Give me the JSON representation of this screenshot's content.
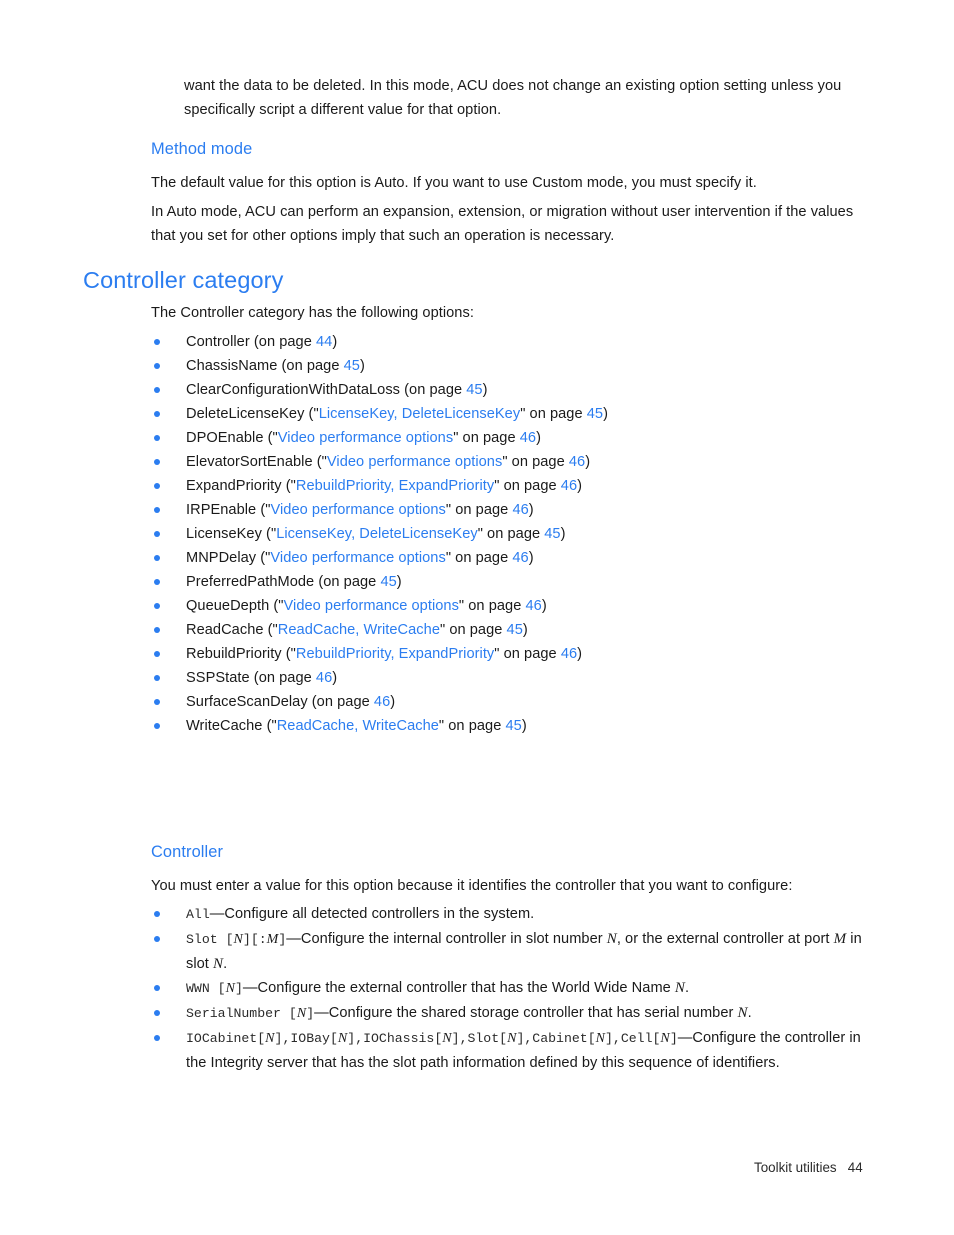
{
  "document": {
    "intro_paragraph": "want the data to be deleted. In this mode, ACU does not change an existing option setting unless you specifically script a different value for that option.",
    "method_mode": {
      "heading": "Method mode",
      "paragraph_1": "The default value for this option is Auto. If you want to use Custom mode, you must specify it.",
      "paragraph_2": "In Auto mode, ACU can perform an expansion, extension, or migration without user intervention if the values that you set for other options imply that such an operation is necessary."
    },
    "controller_category": {
      "heading": "Controller category",
      "intro": "The Controller category has the following options:",
      "options": [
        {
          "name": "Controller",
          "ref_open": " (on page ",
          "link": "",
          "page": "44",
          "ref_close": ")"
        },
        {
          "name": "ChassisName",
          "ref_open": " (on page ",
          "link": "",
          "page": "45",
          "ref_close": ")"
        },
        {
          "name": "ClearConfigurationWithDataLoss",
          "ref_open": " (on page ",
          "link": "",
          "page": "45",
          "ref_close": ")"
        },
        {
          "name": "DeleteLicenseKey",
          "ref_open": " (\"",
          "link": "LicenseKey, DeleteLicenseKey",
          "ref_mid": "\" on page ",
          "page": "45",
          "ref_close": ")"
        },
        {
          "name": "DPOEnable",
          "ref_open": " (\"",
          "link": "Video performance options",
          "ref_mid": "\" on page ",
          "page": "46",
          "ref_close": ")"
        },
        {
          "name": "ElevatorSortEnable",
          "ref_open": " (\"",
          "link": "Video performance options",
          "ref_mid": "\" on page ",
          "page": "46",
          "ref_close": ")"
        },
        {
          "name": "ExpandPriority",
          "ref_open": " (\"",
          "link": "RebuildPriority, ExpandPriority",
          "ref_mid": "\" on page ",
          "page": "46",
          "ref_close": ")"
        },
        {
          "name": "IRPEnable",
          "ref_open": " (\"",
          "link": "Video performance options",
          "ref_mid": "\" on page ",
          "page": "46",
          "ref_close": ")"
        },
        {
          "name": "LicenseKey",
          "ref_open": " (\"",
          "link": "LicenseKey, DeleteLicenseKey",
          "ref_mid": "\" on page ",
          "page": "45",
          "ref_close": ")"
        },
        {
          "name": "MNPDelay",
          "ref_open": " (\"",
          "link": "Video performance options",
          "ref_mid": "\" on page ",
          "page": "46",
          "ref_close": ")"
        },
        {
          "name": "PreferredPathMode",
          "ref_open": " (on page ",
          "link": "",
          "page": "45",
          "ref_close": ")"
        },
        {
          "name": "QueueDepth",
          "ref_open": " (\"",
          "link": "Video performance options",
          "ref_mid": "\" on page ",
          "page": "46",
          "ref_close": ")"
        },
        {
          "name": "ReadCache",
          "ref_open": " (\"",
          "link": "ReadCache, WriteCache",
          "ref_mid": "\" on page ",
          "page": "45",
          "ref_close": ")"
        },
        {
          "name": "RebuildPriority",
          "ref_open": " (\"",
          "link": "RebuildPriority, ExpandPriority",
          "ref_mid": "\" on page ",
          "page": "46",
          "ref_close": ")"
        },
        {
          "name": "SSPState",
          "ref_open": " (on page ",
          "link": "",
          "page": "46",
          "ref_close": ")"
        },
        {
          "name": "SurfaceScanDelay",
          "ref_open": " (on page ",
          "link": "",
          "page": "46",
          "ref_close": ")"
        },
        {
          "name": "WriteCache",
          "ref_open": " (\"",
          "link": "ReadCache, WriteCache",
          "ref_mid": "\" on page ",
          "page": "45",
          "ref_close": ")"
        }
      ]
    },
    "controller": {
      "heading": "Controller",
      "intro": "You must enter a value for this option because it identifies the controller that you want to configure:",
      "items": [
        {
          "code": "All",
          "desc": "—Configure all detected controllers in the system."
        },
        {
          "code": "Slot [N][:M]",
          "desc": "—Configure the internal controller in slot number N, or the external controller at port M in slot N."
        },
        {
          "code": "WWN [N]",
          "desc": "—Configure the external controller that has the World Wide Name N."
        },
        {
          "code": "SerialNumber [N]",
          "desc": "—Configure the shared storage controller that has serial number N."
        },
        {
          "code": "IOCabinet[N],IOBay[N],IOChassis[N],Slot[N],Cabinet[N],Cell[N]",
          "desc": "—Configure the controller in the Integrity server that has the slot path information defined by this sequence of identifiers."
        }
      ]
    },
    "footer": {
      "chapter": "Toolkit utilities",
      "page_number": "44",
      "text": "Toolkit utilities   44"
    },
    "colors": {
      "heading_blue": "#2b7df0",
      "link_blue": "#2b7df0",
      "body_text": "#1a1a1a",
      "code_gray": "#2b2b2b",
      "background": "#ffffff"
    }
  }
}
